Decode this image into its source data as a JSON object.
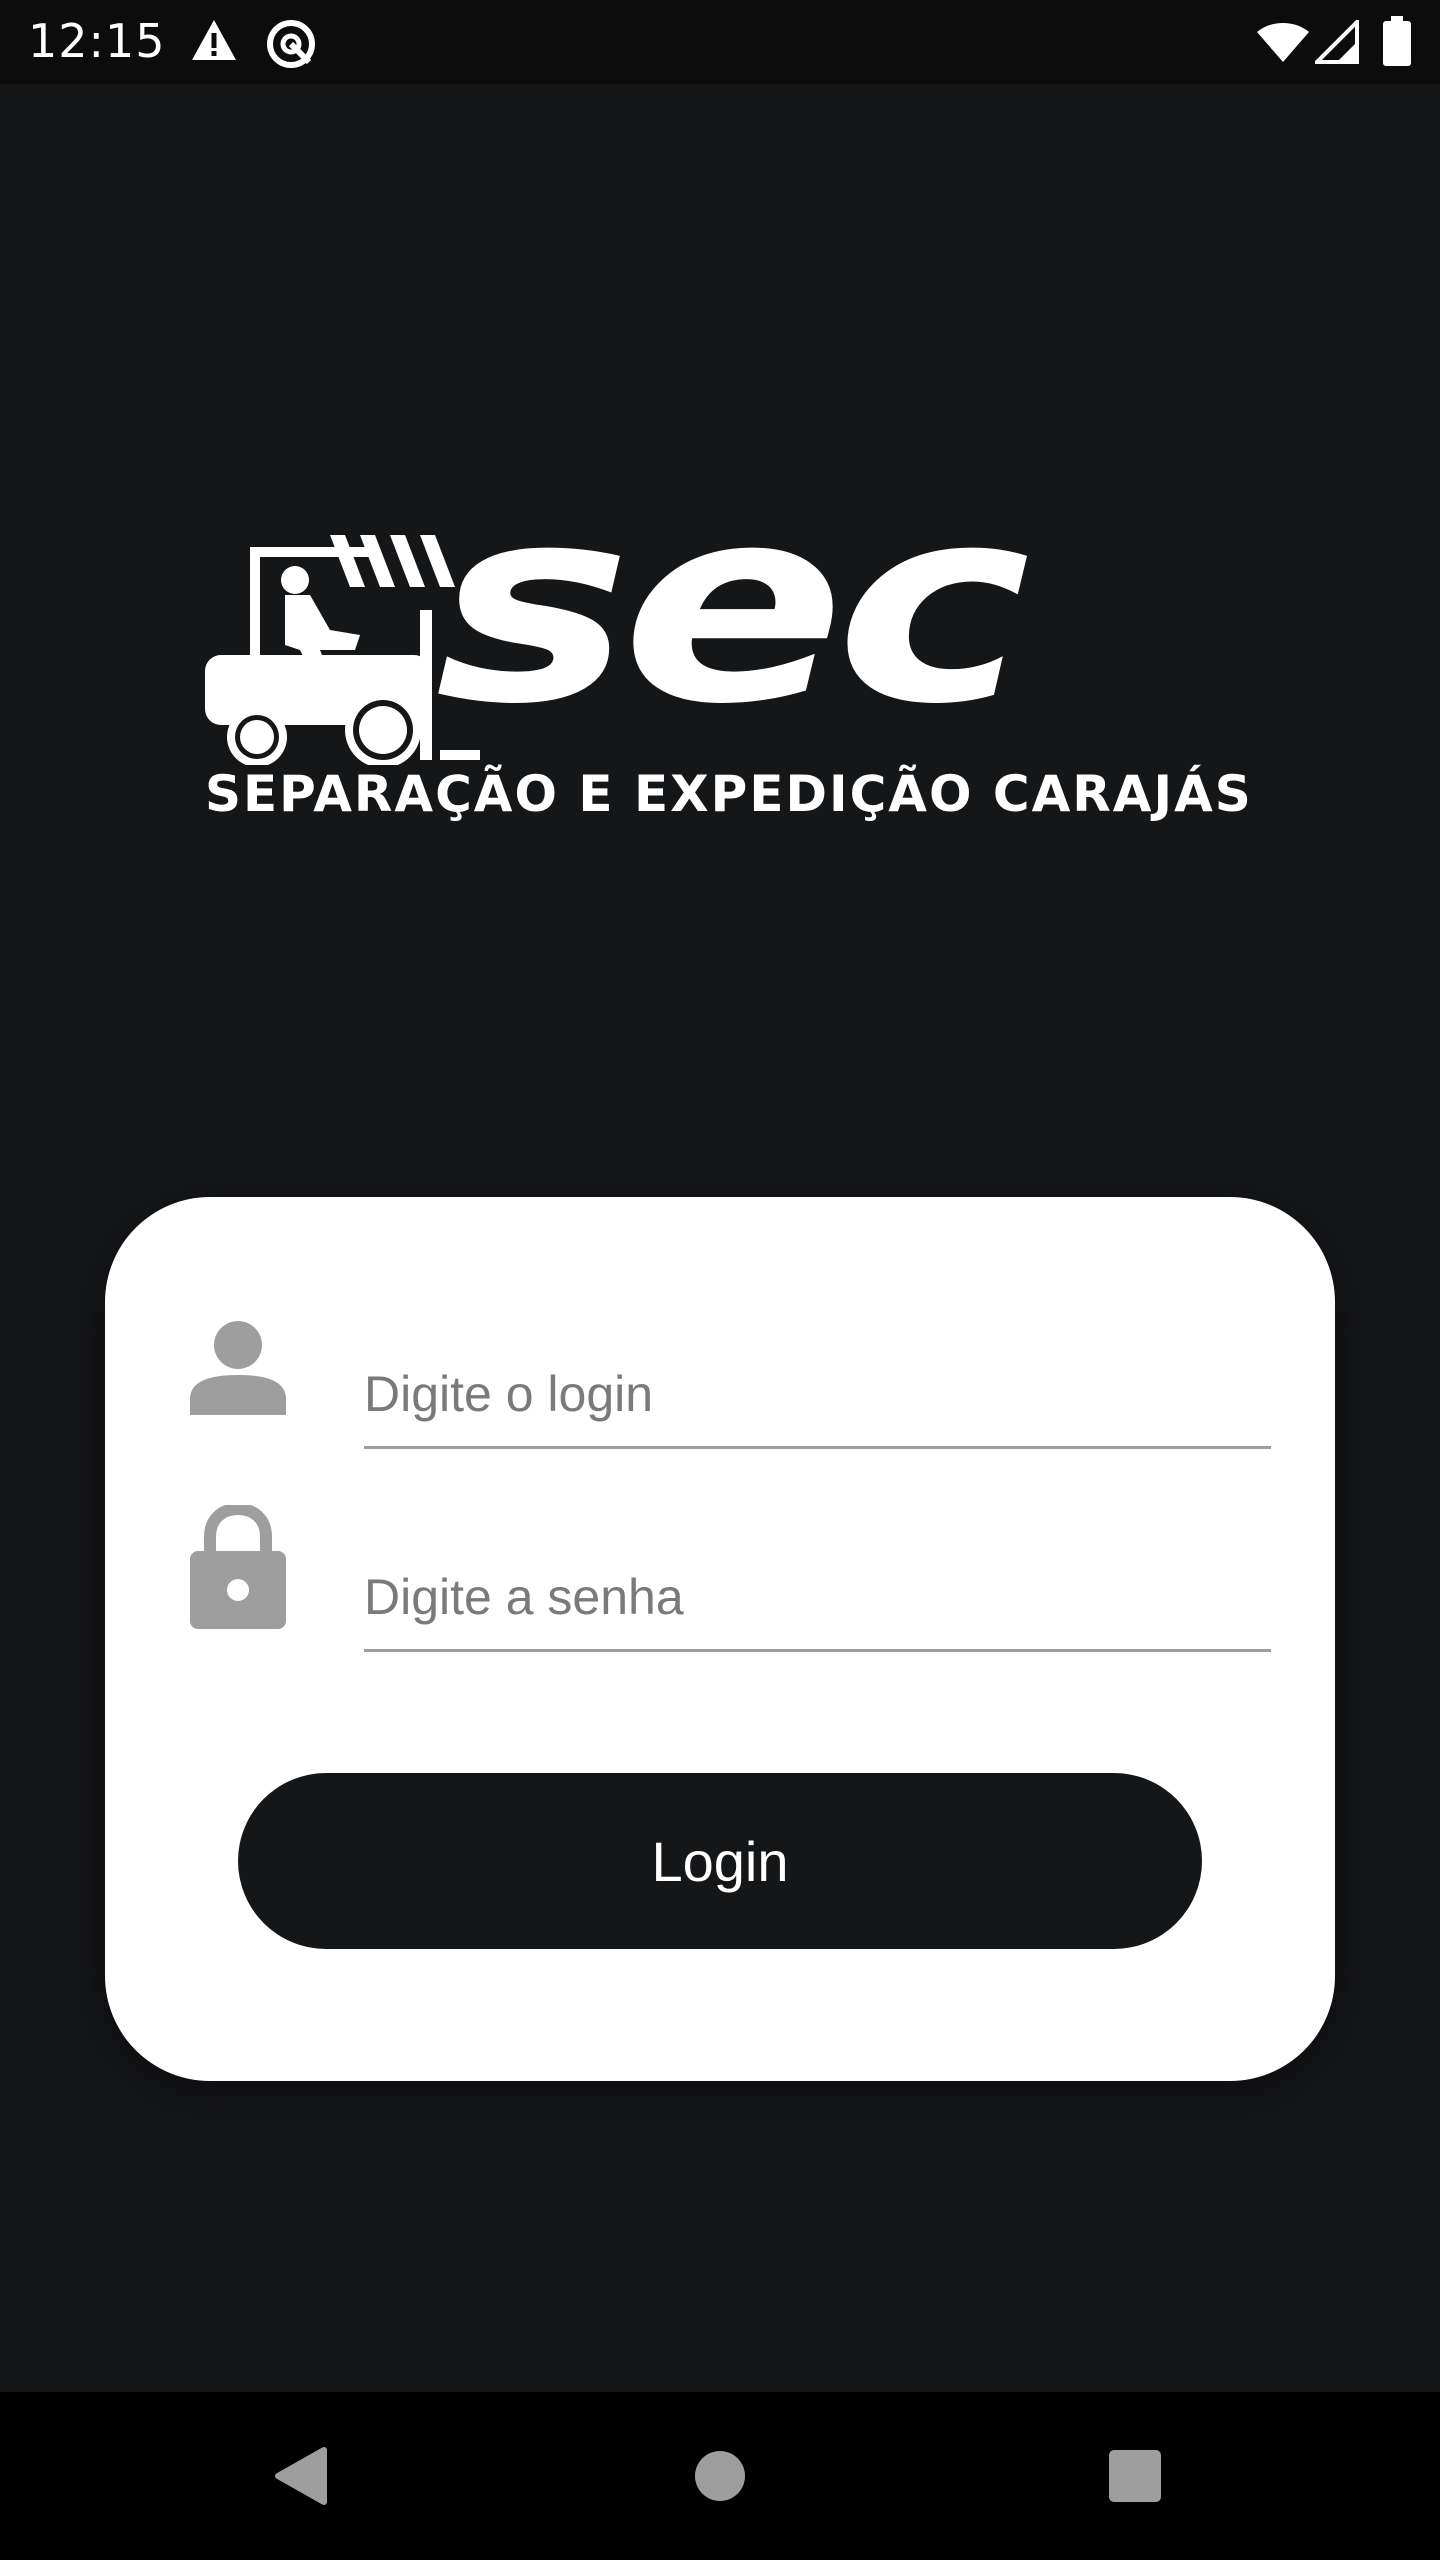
{
  "status_bar": {
    "time": "12:15",
    "icons": [
      "warning-icon",
      "sync-icon",
      "wifi-icon",
      "cell-signal-icon",
      "battery-icon"
    ]
  },
  "logo": {
    "brand": "SEC",
    "tagline": "SEPARAÇÃO E EXPEDIÇÃO CARAJÁS"
  },
  "login_form": {
    "login_placeholder": "Digite o login",
    "login_value": "",
    "password_placeholder": "Digite a senha",
    "password_value": "",
    "submit_label": "Login"
  },
  "nav_bar": {
    "buttons": [
      "back-icon",
      "home-icon",
      "recents-icon"
    ]
  },
  "colors": {
    "background": "#151618",
    "card": "#ffffff",
    "button": "#151618",
    "icon_gray": "#9e9e9e"
  }
}
